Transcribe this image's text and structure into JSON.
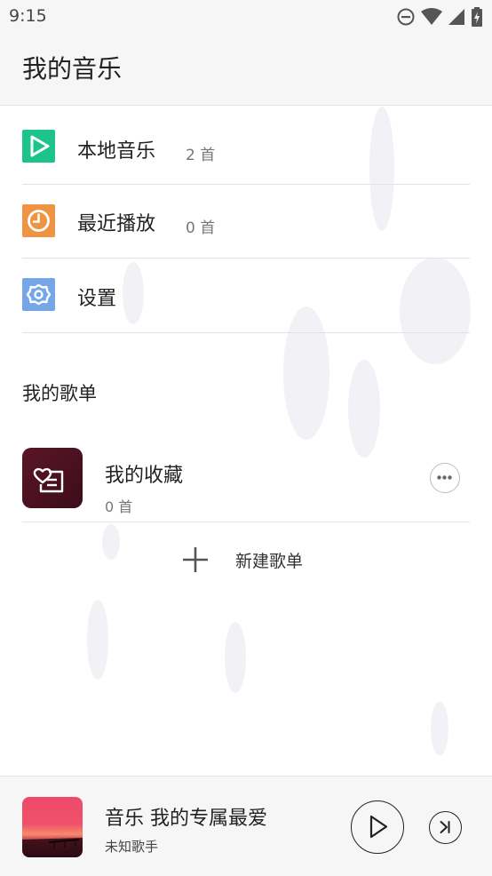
{
  "status_bar": {
    "time": "9:15",
    "icons": [
      "do-not-disturb-icon",
      "wifi-icon",
      "cellular-signal-icon",
      "battery-icon"
    ]
  },
  "header": {
    "title": "我的音乐"
  },
  "menu": {
    "items": [
      {
        "label": "本地音乐",
        "count": "2 首",
        "icon": "play-icon",
        "color": "#1dc489"
      },
      {
        "label": "最近播放",
        "count": "0 首",
        "icon": "clock-icon",
        "color": "#ee9442"
      },
      {
        "label": "设置",
        "icon": "gear-icon",
        "color": "#75a7e8"
      }
    ]
  },
  "playlists": {
    "section_title": "我的歌单",
    "items": [
      {
        "name": "我的收藏",
        "count": "0 首",
        "icon": "favorite-list-icon"
      }
    ],
    "new_label": "新建歌单"
  },
  "player": {
    "title": "音乐 我的专属最爱",
    "artist": "未知歌手"
  },
  "colors": {
    "background": "#ffffff",
    "bar": "#f6f6f6",
    "divider": "#e2e2e2",
    "cover": "#4a1222"
  }
}
